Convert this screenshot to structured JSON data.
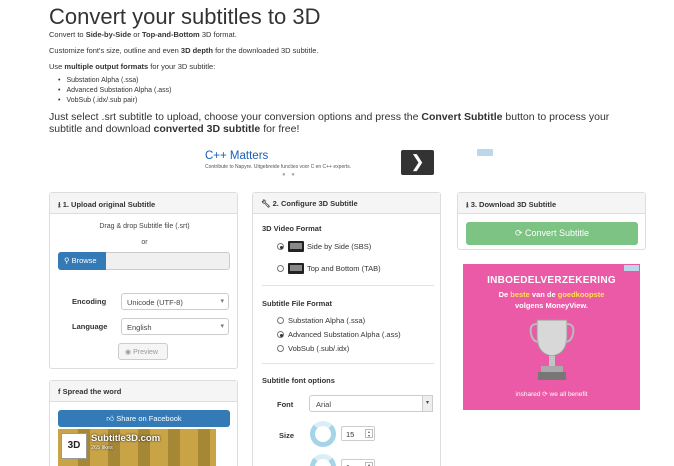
{
  "page": {
    "title": "Convert your subtitles to 3D",
    "p1": {
      "a": "Convert to ",
      "b1": "Side-by-Side",
      "c": " or ",
      "b2": "Top-and-Bottom",
      "d": " 3D format."
    },
    "p2": {
      "a": "Customize font's size, outline and even ",
      "b": "3D depth",
      "c": " for the downloaded 3D subtitle."
    },
    "p3": {
      "a": "Use ",
      "b": "multiple output formats",
      "c": " for your 3D subtitle:"
    },
    "formats": [
      "Substation Alpha (.ssa)",
      "Advanced Substation Alpha (.ass)",
      "VobSub (.idx/.sub pair)"
    ],
    "intro": {
      "a": "Just select .srt subtitle to upload, choose your conversion options and press the ",
      "b1": "Convert Subtitle",
      "c": " button to process your subtitle and download ",
      "b2": "converted 3D subtitle",
      "d": " for free!"
    }
  },
  "ad_top": {
    "title": "C++ Matters",
    "subtitle": "Contribute to Napyre. Uitgebreide functies voor C en C++ experts.",
    "arrow": "❯",
    "dots": "● ●"
  },
  "upload": {
    "header": "1. Upload original Subtitle",
    "drag": "Drag & drop Subtitle file (.srt)",
    "or": "or",
    "browse": "Browse",
    "encoding_label": "Encoding",
    "encoding_value": "Unicode (UTF-8)",
    "language_label": "Language",
    "language_value": "English",
    "preview": "Preview"
  },
  "config": {
    "header": "2. Configure 3D Subtitle",
    "video_format_label": "3D Video Format",
    "video_formats": [
      {
        "label": "Side by Side (SBS)",
        "selected": true
      },
      {
        "label": "Top and Bottom (TAB)",
        "selected": false
      }
    ],
    "file_format_label": "Subtitle File Format",
    "file_formats": [
      {
        "label": "Substation Alpha (.ssa)",
        "selected": false
      },
      {
        "label": "Advanced Substation Alpha (.ass)",
        "selected": true
      },
      {
        "label": "VobSub (.sub/.idx)",
        "selected": false
      }
    ],
    "font_options_label": "Subtitle font options",
    "font_label": "Font",
    "font_value": "Arial",
    "size_label": "Size",
    "size_value": "15",
    "outline_value": "1"
  },
  "download": {
    "header": "3. Download 3D Subtitle",
    "convert": "Convert Subtitle"
  },
  "pink_ad": {
    "heading": "INBOEDELVERZEKERING",
    "line1a": "De ",
    "line1b": "beste",
    "line1c": " van de ",
    "line1d": "goedkoopste",
    "line2": "volgens MoneyView.",
    "footer": "inshared ⟳ we all benefit"
  },
  "spread": {
    "header": "Spread the word",
    "share": "Share on Facebook",
    "page_name": "Subtitle3D.com",
    "likes": "265 likes",
    "logo": "3D"
  },
  "colors": {
    "primary": "#337ab7",
    "convert": "#7dc383",
    "ad_pink": "#ea5aa6"
  }
}
